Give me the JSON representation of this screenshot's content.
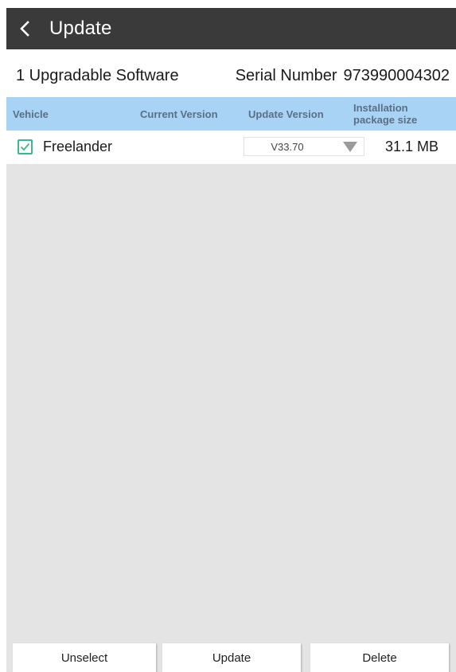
{
  "header": {
    "title": "Update",
    "back_icon": "chevron-left-icon"
  },
  "info": {
    "upgradable_count_text": "1 Upgradable Software",
    "serial_label": "Serial Number",
    "serial_value": "973990004302"
  },
  "table": {
    "columns": {
      "vehicle": "Vehicle",
      "current_version": "Current Version",
      "update_version": "Update Version",
      "package_size_line1": "Installation",
      "package_size_line2": "package size"
    },
    "rows": [
      {
        "checked": true,
        "vehicle": "Freelander",
        "current_version": "",
        "update_version": "V33.70",
        "package_size": "31.1 MB"
      }
    ]
  },
  "actions": {
    "unselect": "Unselect",
    "update": "Update",
    "delete": "Delete"
  },
  "colors": {
    "header_bg": "#3a3a3a",
    "table_header_bg": "#a9d3f5",
    "checkbox_accent": "#3cb98b",
    "list_bg": "#e4e4e4"
  }
}
